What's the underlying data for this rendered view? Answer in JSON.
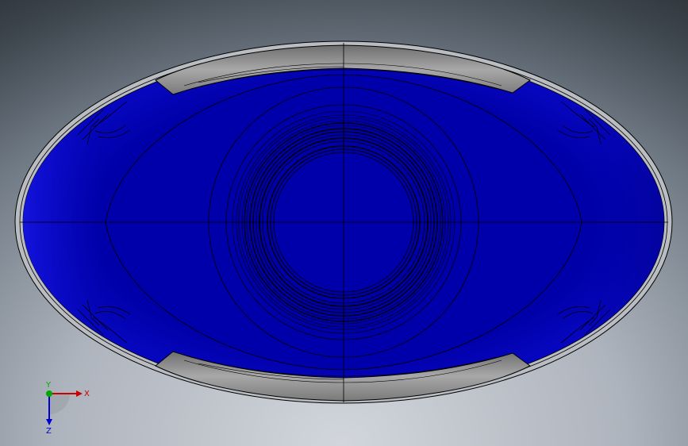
{
  "viewport": {
    "background_top": "#262b30",
    "background_bottom": "#d2d6dc"
  },
  "part": {
    "body_color": "#0000aa",
    "highlight_color": "#1a1ae6",
    "rim_color": "#9a9a9a",
    "edge_color": "#000000"
  },
  "triad": {
    "x_label": "X",
    "y_label": "Y",
    "z_label": "Z",
    "x_color": "#cc0000",
    "y_color": "#00aa00",
    "z_color": "#0000cc"
  }
}
